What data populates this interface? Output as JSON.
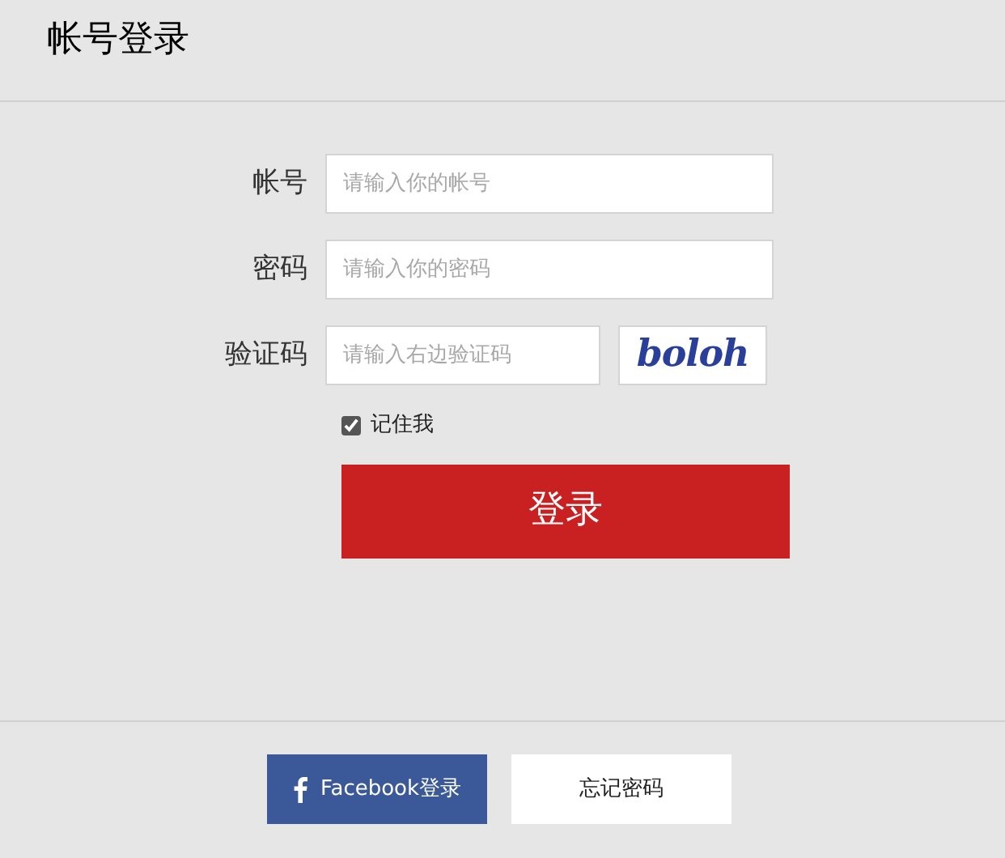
{
  "page": {
    "title": "帐号登录"
  },
  "fields": [
    {
      "kind": "text",
      "label": "帐号",
      "placeholder": "请输入你的帐号"
    },
    {
      "kind": "password",
      "label": "密码",
      "placeholder": "请输入你的密码"
    },
    {
      "kind": "captcha",
      "label": "验证码",
      "placeholder": "请输入右边验证码",
      "captcha": "boloh"
    }
  ],
  "remember": {
    "label": "记住我",
    "checked": true
  },
  "login_button": "登录",
  "footer_buttons": [
    {
      "kind": "facebook",
      "label": "Facebook登录"
    },
    {
      "kind": "plain",
      "label": "忘记密码"
    }
  ]
}
